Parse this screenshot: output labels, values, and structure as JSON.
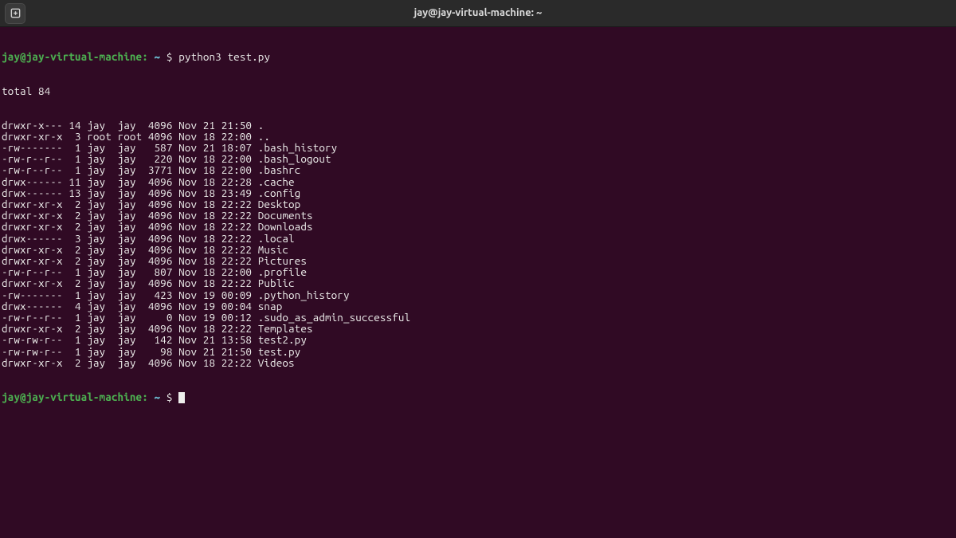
{
  "titlebar": {
    "title": "jay@jay-virtual-machine: ~"
  },
  "prompt": {
    "user_host": "jay@jay-virtual-machine",
    "separator": ":",
    "path": "~",
    "dollar": "$"
  },
  "command1": "python3 test.py",
  "output": {
    "total_line": "total 84",
    "rows": [
      {
        "perm": "drwxr-x---",
        "links": "14",
        "owner": "jay ",
        "group": "jay ",
        "size": "4096",
        "month": "Nov",
        "day": "21",
        "time": "21:50",
        "name": "."
      },
      {
        "perm": "drwxr-xr-x",
        "links": " 3",
        "owner": "root",
        "group": "root",
        "size": "4096",
        "month": "Nov",
        "day": "18",
        "time": "22:00",
        "name": ".."
      },
      {
        "perm": "-rw-------",
        "links": " 1",
        "owner": "jay ",
        "group": "jay ",
        "size": " 587",
        "month": "Nov",
        "day": "21",
        "time": "18:07",
        "name": ".bash_history"
      },
      {
        "perm": "-rw-r--r--",
        "links": " 1",
        "owner": "jay ",
        "group": "jay ",
        "size": " 220",
        "month": "Nov",
        "day": "18",
        "time": "22:00",
        "name": ".bash_logout"
      },
      {
        "perm": "-rw-r--r--",
        "links": " 1",
        "owner": "jay ",
        "group": "jay ",
        "size": "3771",
        "month": "Nov",
        "day": "18",
        "time": "22:00",
        "name": ".bashrc"
      },
      {
        "perm": "drwx------",
        "links": "11",
        "owner": "jay ",
        "group": "jay ",
        "size": "4096",
        "month": "Nov",
        "day": "18",
        "time": "22:28",
        "name": ".cache"
      },
      {
        "perm": "drwx------",
        "links": "13",
        "owner": "jay ",
        "group": "jay ",
        "size": "4096",
        "month": "Nov",
        "day": "18",
        "time": "23:49",
        "name": ".config"
      },
      {
        "perm": "drwxr-xr-x",
        "links": " 2",
        "owner": "jay ",
        "group": "jay ",
        "size": "4096",
        "month": "Nov",
        "day": "18",
        "time": "22:22",
        "name": "Desktop"
      },
      {
        "perm": "drwxr-xr-x",
        "links": " 2",
        "owner": "jay ",
        "group": "jay ",
        "size": "4096",
        "month": "Nov",
        "day": "18",
        "time": "22:22",
        "name": "Documents"
      },
      {
        "perm": "drwxr-xr-x",
        "links": " 2",
        "owner": "jay ",
        "group": "jay ",
        "size": "4096",
        "month": "Nov",
        "day": "18",
        "time": "22:22",
        "name": "Downloads"
      },
      {
        "perm": "drwx------",
        "links": " 3",
        "owner": "jay ",
        "group": "jay ",
        "size": "4096",
        "month": "Nov",
        "day": "18",
        "time": "22:22",
        "name": ".local"
      },
      {
        "perm": "drwxr-xr-x",
        "links": " 2",
        "owner": "jay ",
        "group": "jay ",
        "size": "4096",
        "month": "Nov",
        "day": "18",
        "time": "22:22",
        "name": "Music"
      },
      {
        "perm": "drwxr-xr-x",
        "links": " 2",
        "owner": "jay ",
        "group": "jay ",
        "size": "4096",
        "month": "Nov",
        "day": "18",
        "time": "22:22",
        "name": "Pictures"
      },
      {
        "perm": "-rw-r--r--",
        "links": " 1",
        "owner": "jay ",
        "group": "jay ",
        "size": " 807",
        "month": "Nov",
        "day": "18",
        "time": "22:00",
        "name": ".profile"
      },
      {
        "perm": "drwxr-xr-x",
        "links": " 2",
        "owner": "jay ",
        "group": "jay ",
        "size": "4096",
        "month": "Nov",
        "day": "18",
        "time": "22:22",
        "name": "Public"
      },
      {
        "perm": "-rw-------",
        "links": " 1",
        "owner": "jay ",
        "group": "jay ",
        "size": " 423",
        "month": "Nov",
        "day": "19",
        "time": "00:09",
        "name": ".python_history"
      },
      {
        "perm": "drwx------",
        "links": " 4",
        "owner": "jay ",
        "group": "jay ",
        "size": "4096",
        "month": "Nov",
        "day": "19",
        "time": "00:04",
        "name": "snap"
      },
      {
        "perm": "-rw-r--r--",
        "links": " 1",
        "owner": "jay ",
        "group": "jay ",
        "size": "   0",
        "month": "Nov",
        "day": "19",
        "time": "00:12",
        "name": ".sudo_as_admin_successful"
      },
      {
        "perm": "drwxr-xr-x",
        "links": " 2",
        "owner": "jay ",
        "group": "jay ",
        "size": "4096",
        "month": "Nov",
        "day": "18",
        "time": "22:22",
        "name": "Templates"
      },
      {
        "perm": "-rw-rw-r--",
        "links": " 1",
        "owner": "jay ",
        "group": "jay ",
        "size": " 142",
        "month": "Nov",
        "day": "21",
        "time": "13:58",
        "name": "test2.py"
      },
      {
        "perm": "-rw-rw-r--",
        "links": " 1",
        "owner": "jay ",
        "group": "jay ",
        "size": "  98",
        "month": "Nov",
        "day": "21",
        "time": "21:50",
        "name": "test.py"
      },
      {
        "perm": "drwxr-xr-x",
        "links": " 2",
        "owner": "jay ",
        "group": "jay ",
        "size": "4096",
        "month": "Nov",
        "day": "18",
        "time": "22:22",
        "name": "Videos"
      }
    ]
  }
}
